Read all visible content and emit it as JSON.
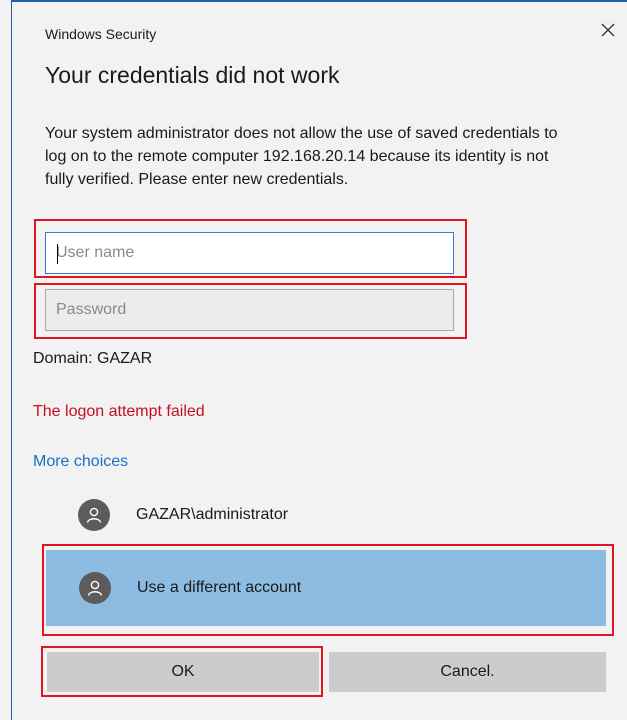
{
  "window": {
    "title": "Windows Security",
    "close_icon": "close-icon"
  },
  "heading": "Your credentials did not work",
  "message": "Your system administrator does not allow the use of saved credentials to log on to the remote computer 192.168.20.14 because its identity is not fully verified. Please enter new credentials.",
  "form": {
    "username": {
      "value": "",
      "placeholder": "User name"
    },
    "password": {
      "value": "",
      "placeholder": "Password"
    },
    "domain": "Domain: GAZAR"
  },
  "error": "The logon attempt failed",
  "more_choices": "More choices",
  "accounts": [
    {
      "label": "GAZAR\\administrator",
      "icon": "user-icon",
      "selected": false
    },
    {
      "label": "Use a different account",
      "icon": "user-icon",
      "selected": true
    }
  ],
  "buttons": {
    "ok": "OK",
    "cancel": "Cancel."
  },
  "colors": {
    "error": "#c50f1f",
    "link": "#1b6fc9",
    "selected_account": "#8cbce2",
    "highlight_box": "#e0141e",
    "button": "#cccccc"
  }
}
